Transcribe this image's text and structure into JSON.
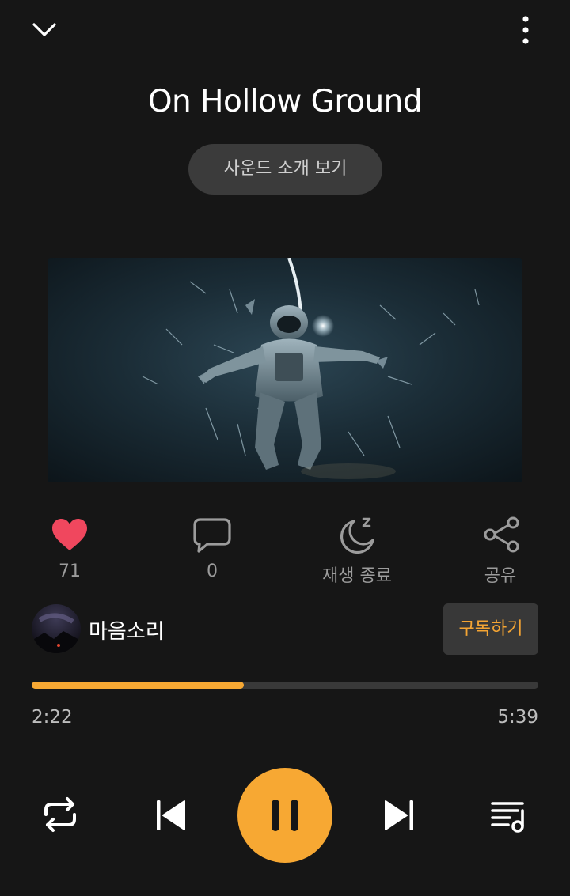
{
  "header": {
    "collapse_icon": "chevron-down-icon",
    "more_icon": "more-vertical-icon"
  },
  "track": {
    "title": "On Hollow Ground",
    "intro_label": "사운드 소개 보기",
    "cover_image": "astronaut-cover"
  },
  "actions": {
    "like": {
      "icon": "heart-icon",
      "label": "71",
      "color": "#f0475e"
    },
    "comment": {
      "icon": "comment-icon",
      "label": "0"
    },
    "sleep_timer": {
      "icon": "moon-zzz-icon",
      "label": "재생 종료"
    },
    "share": {
      "icon": "share-icon",
      "label": "공유"
    }
  },
  "channel": {
    "name": "마음소리",
    "subscribe_label": "구독하기"
  },
  "playback": {
    "elapsed": "2:22",
    "total": "5:39",
    "progress_fraction": 0.419,
    "accent_color": "#f7a833"
  },
  "controls": {
    "repeat_icon": "repeat-icon",
    "previous_icon": "skip-previous-icon",
    "play_state": "pause-icon",
    "next_icon": "skip-next-icon",
    "playlist_icon": "playlist-icon"
  }
}
